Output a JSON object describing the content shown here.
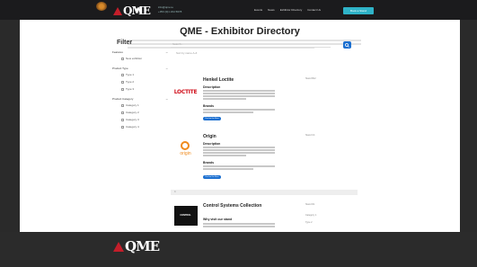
{
  "header": {
    "logo_text": "QME",
    "contact_line1": "info@qme.ie",
    "contact_line2": "+353 (0)1 234 5678",
    "nav": [
      "Events",
      "News",
      "Exhibitor Directory",
      "Contact Us"
    ],
    "cta_label": "Book a Stand"
  },
  "page": {
    "title": "QME - Exhibitor Directory",
    "filter_title": "Filter",
    "search_placeholder": "Search...",
    "sort_label": "Sort by name A-Z",
    "divider_label": "C"
  },
  "filters": {
    "groups": [
      {
        "label": "Features",
        "items": [
          "New exhibitor"
        ]
      },
      {
        "label": "Product Type",
        "items": [
          "Type 1",
          "Type 2",
          "Type 3"
        ]
      },
      {
        "label": "Product Category",
        "items": [
          "Category 1",
          "Category 2",
          "Category 3",
          "Category 4"
        ]
      }
    ]
  },
  "exhibitors": [
    {
      "name": "Henkel Loctite",
      "logo_text": "LOCTITE",
      "description_label": "Description",
      "brands_label": "Brands",
      "button_label": "Find on the Floor",
      "stand": "Stand B12"
    },
    {
      "name": "Origin",
      "logo_text": "origin",
      "description_label": "Description",
      "brands_label": "Brands",
      "button_label": "Find on the Floor",
      "stand": "Stand C4"
    },
    {
      "name": "Control Systems Collection",
      "logo_text": "CONTROL",
      "description_label": "Why visit our stand",
      "stand": "Stand D1",
      "side_items": [
        "Category 1",
        "Type 2"
      ]
    }
  ],
  "footer": {
    "logo_text": "QME"
  },
  "colors": {
    "accent": "#1b6fd0",
    "teal": "#2fb3c8",
    "brand_red": "#c41e2a"
  }
}
